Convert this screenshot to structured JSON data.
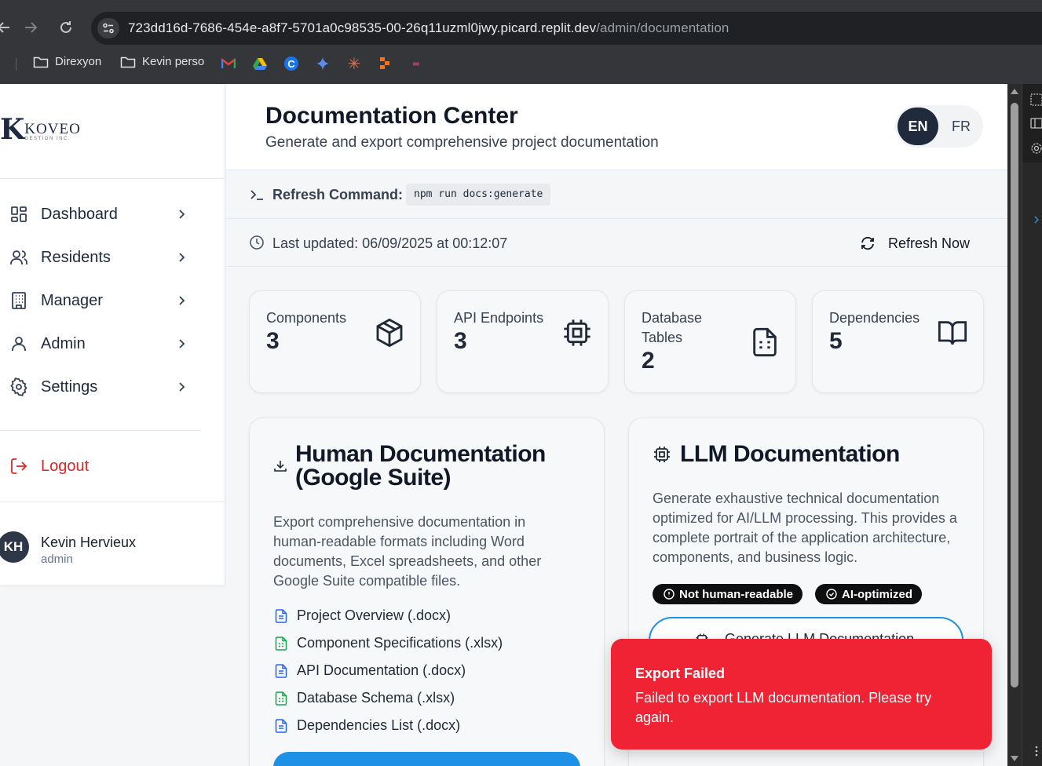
{
  "browser": {
    "url_host": "723dd16d-7686-454e-a8f7-5701a0c98535-00-26q11uzml0jwy.picard.replit.dev",
    "url_path": "/admin/documentation",
    "bookmarks": [
      {
        "label": "Direxyon",
        "icon": "folder-icon"
      },
      {
        "label": "Kevin perso",
        "icon": "folder-icon"
      }
    ],
    "bookmark_icons": [
      "gmail-icon",
      "drive-icon",
      "chrome-c-icon",
      "gemini-icon",
      "claude-icon",
      "app-icon",
      "link-icon"
    ]
  },
  "sidebar": {
    "logo_letter": "K",
    "logo_name": "KOVEO",
    "logo_tagline": "GESTION INC.",
    "nav_items": [
      {
        "label": "Dashboard",
        "icon": "dashboard-icon"
      },
      {
        "label": "Residents",
        "icon": "users-icon"
      },
      {
        "label": "Manager",
        "icon": "building-icon"
      },
      {
        "label": "Admin",
        "icon": "user-icon"
      },
      {
        "label": "Settings",
        "icon": "gear-icon"
      }
    ],
    "logout_label": "Logout",
    "user": {
      "initials": "KH",
      "name": "Kevin Hervieux",
      "role": "admin"
    }
  },
  "header": {
    "title": "Documentation Center",
    "subtitle": "Generate and export comprehensive project documentation",
    "lang_en": "EN",
    "lang_fr": "FR",
    "active_lang": "EN"
  },
  "command": {
    "label": "Refresh Command:",
    "code": "npm run docs:generate"
  },
  "update": {
    "text": "Last updated: 06/09/2025 at 00:12:07",
    "refresh_label": "Refresh Now"
  },
  "stats": [
    {
      "label": "Components",
      "value": "3",
      "icon": "cube-icon"
    },
    {
      "label": "API Endpoints",
      "value": "3",
      "icon": "chip-icon"
    },
    {
      "label": "Database Tables",
      "value": "2",
      "icon": "file-table-icon"
    },
    {
      "label": "Dependencies",
      "value": "5",
      "icon": "book-open-icon"
    }
  ],
  "human_doc": {
    "title_line1": "Human Documentation",
    "title_line2": "(Google Suite)",
    "description": "Export comprehensive documentation in human-readable formats including Word documents, Excel spreadsheets, and other Google Suite compatible files.",
    "files": [
      {
        "label": "Project Overview (.docx)",
        "color": "#2563eb"
      },
      {
        "label": "Component Specifications (.xlsx)",
        "color": "#16a34a"
      },
      {
        "label": "API Documentation (.docx)",
        "color": "#2563eb"
      },
      {
        "label": "Database Schema (.xlsx)",
        "color": "#16a34a"
      },
      {
        "label": "Dependencies List (.docx)",
        "color": "#2563eb"
      }
    ]
  },
  "llm_doc": {
    "title": "LLM Documentation",
    "description": "Generate exhaustive technical documentation optimized for AI/LLM processing. This provides a complete portrait of the application architecture, components, and business logic.",
    "badge_not_readable": "Not human-readable",
    "badge_ai": "AI-optimized",
    "generate_label": "Generate LLM Documentation"
  },
  "toast": {
    "title": "Export Failed",
    "message": "Failed to export LLM documentation. Please try again."
  },
  "colors": {
    "accent": "#1e90e6",
    "danger": "#ef2333",
    "logout": "#dc2626",
    "dark": "#1f2a3c"
  }
}
